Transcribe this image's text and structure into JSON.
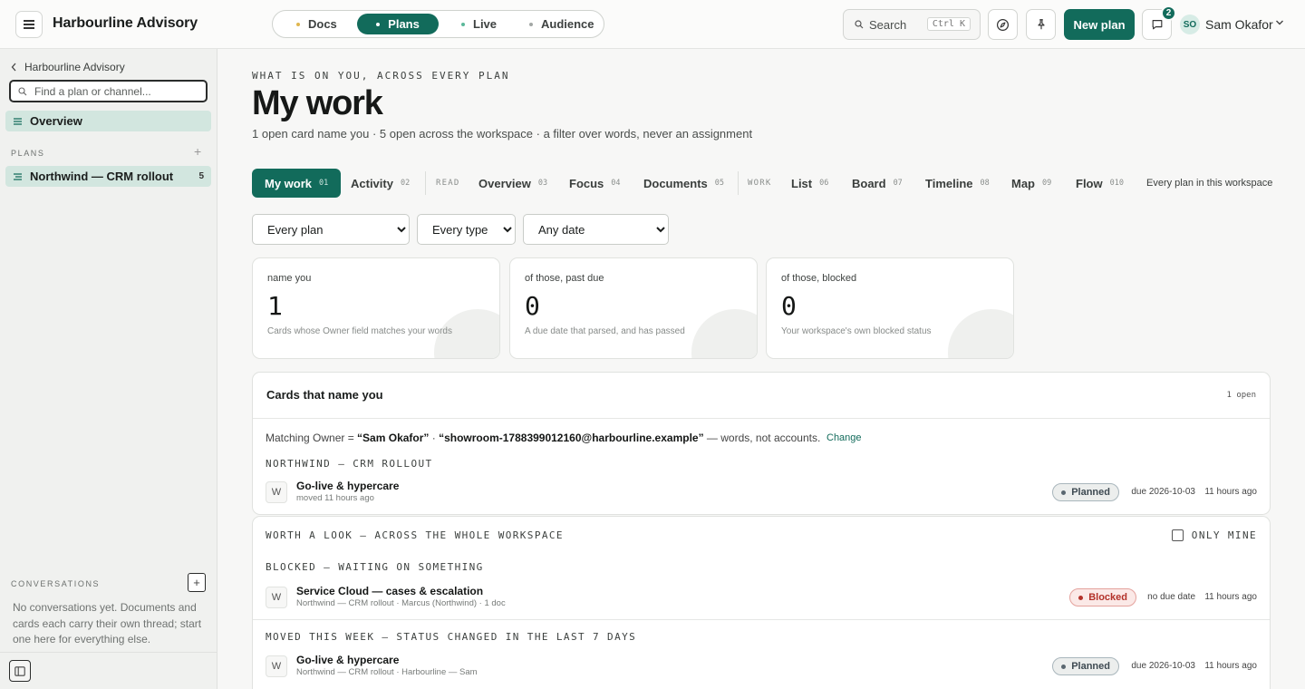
{
  "topbar": {
    "brand": "Harbourline Advisory",
    "modes": [
      {
        "label": "Docs",
        "dot": "#e0b64e"
      },
      {
        "label": "Plans",
        "dot": "#ffffff"
      },
      {
        "label": "Live",
        "dot": "#5bb89a"
      },
      {
        "label": "Audience",
        "dot": "#a3a7a5"
      }
    ],
    "active_mode": "Plans",
    "search_label": "Search",
    "search_shortcut": "Ctrl K",
    "new_plan": "New plan",
    "messages_badge": "2",
    "user_initials": "SO",
    "user_name": "Sam Okafor",
    "accent": "#126b5b"
  },
  "sidebar": {
    "back_label": "Harbourline Advisory",
    "search_placeholder": "Find a plan or channel...",
    "overview": "Overview",
    "plans_heading": "PLANS",
    "plans": [
      {
        "name": "Northwind — CRM rollout",
        "count": "5"
      }
    ],
    "conversations_heading": "CONVERSATIONS",
    "conversations_empty": "No conversations yet. Documents and cards each carry their own thread; start one here for everything else."
  },
  "main": {
    "eyebrow": "WHAT IS ON YOU, ACROSS EVERY PLAN",
    "title": "My work",
    "subtitle": "1 open card name you · 5 open across the workspace · a filter over words, never an assignment",
    "tabs": [
      {
        "label": "My work",
        "num": "01"
      },
      {
        "label": "Activity",
        "num": "02"
      },
      {
        "label": "Overview",
        "num": "03"
      },
      {
        "label": "Focus",
        "num": "04"
      },
      {
        "label": "Documents",
        "num": "05"
      },
      {
        "label": "List",
        "num": "06"
      },
      {
        "label": "Board",
        "num": "07"
      },
      {
        "label": "Timeline",
        "num": "08"
      },
      {
        "label": "Map",
        "num": "09"
      },
      {
        "label": "Flow",
        "num": "010"
      }
    ],
    "tab_groups": {
      "read": "READ",
      "work": "WORK"
    },
    "tab_all": "Every plan in this workspace",
    "filters": {
      "plan": {
        "selected": "Every plan",
        "options": [
          "Every plan"
        ]
      },
      "type": {
        "selected": "Every type",
        "options": [
          "Every type"
        ]
      },
      "date": {
        "selected": "Any date",
        "options": [
          "Any date"
        ]
      }
    },
    "stats": [
      {
        "label": "name you",
        "value": "1",
        "desc": "Cards whose Owner field matches your words"
      },
      {
        "label": "of those, past due",
        "value": "0",
        "desc": "A due date that parsed, and has passed"
      },
      {
        "label": "of those, blocked",
        "value": "0",
        "desc": "Your workspace's own blocked status"
      }
    ],
    "mine_panel": {
      "heading": "Cards that name you",
      "count": "1 open",
      "match_prefix": "Matching Owner = ",
      "match_name": "“Sam Okafor”",
      "match_sep": " · ",
      "match_email": "“showroom-1788399012160@harbourline.example”",
      "match_suffix": " — words, not accounts.",
      "change": "Change",
      "group": "NORTHWIND — CRM ROLLOUT",
      "card": {
        "initial": "W",
        "title": "Go-live & hypercare",
        "sub": "moved 11 hours ago",
        "status": "Planned",
        "due": "due 2026-10-03",
        "time": "11 hours ago"
      }
    },
    "workspace_panel": {
      "heading": "WORTH A LOOK — ACROSS THE WHOLE WORKSPACE",
      "only_mine": "ONLY MINE",
      "blocked_heading": "BLOCKED — WAITING ON SOMETHING",
      "blocked_card": {
        "initial": "W",
        "title": "Service Cloud — cases & escalation",
        "sub": "Northwind — CRM rollout · Marcus (Northwind) · 1 doc",
        "status": "Blocked",
        "due": "no due date",
        "time": "11 hours ago"
      },
      "moved_heading": "MOVED THIS WEEK — STATUS CHANGED IN THE LAST 7 DAYS",
      "moved_card": {
        "initial": "W",
        "title": "Go-live & hypercare",
        "sub": "Northwind — CRM rollout · Harbourline — Sam",
        "status": "Planned",
        "due": "due 2026-10-03",
        "time": "11 hours ago"
      }
    }
  }
}
